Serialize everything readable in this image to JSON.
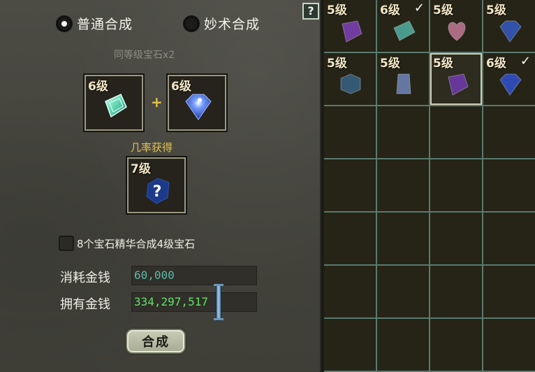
{
  "help_button": {
    "label": "?"
  },
  "mode": {
    "options": [
      {
        "label": "普通合成",
        "selected": true
      },
      {
        "label": "妙术合成",
        "selected": false
      }
    ]
  },
  "compose": {
    "subtitle": "同等级宝石x2",
    "input_slots": [
      {
        "level": "6级",
        "gem_color": "#5fd6b0",
        "icon": "cyan-gem-icon"
      },
      {
        "level": "6级",
        "gem_color": "#3d6cf0",
        "icon": "blue-gem-icon"
      }
    ],
    "plus": "+",
    "result_label": "几率获得",
    "result_slot": {
      "level": "7级",
      "symbol": "?",
      "icon": "mystery-gem-icon"
    }
  },
  "essence_option": {
    "label": "8个宝石精华合成4级宝石",
    "checked": false
  },
  "money": {
    "cost_label": "消耗金钱",
    "cost_value": "60,000",
    "owned_label": "拥有金钱",
    "owned_value": "334,297,517"
  },
  "compose_button": {
    "label": "合成"
  },
  "inventory": {
    "items": [
      {
        "level": "5级",
        "checked": false,
        "color": "#7a3fb0",
        "icon": "purple-gem-icon"
      },
      {
        "level": "6级",
        "checked": true,
        "color": "#4ea89a",
        "icon": "teal-gem-icon"
      },
      {
        "level": "5级",
        "checked": false,
        "color": "#b9738f",
        "icon": "pink-heart-gem-icon"
      },
      {
        "level": "5级",
        "checked": false,
        "color": "#3456b8",
        "icon": "blue-gem-icon"
      },
      {
        "level": "5级",
        "checked": false,
        "color": "#365f7e",
        "icon": "dark-cube-gem-icon"
      },
      {
        "level": "5级",
        "checked": false,
        "color": "#6c7fb2",
        "icon": "slate-gem-icon"
      },
      {
        "level": "5级",
        "checked": false,
        "color": "#6d3aa8",
        "icon": "purple-gem-icon",
        "selected": true
      },
      {
        "level": "6级",
        "checked": true,
        "color": "#3050c4",
        "icon": "blue-gem-icon"
      }
    ],
    "check_mark": "✓",
    "total_cells": 28
  }
}
